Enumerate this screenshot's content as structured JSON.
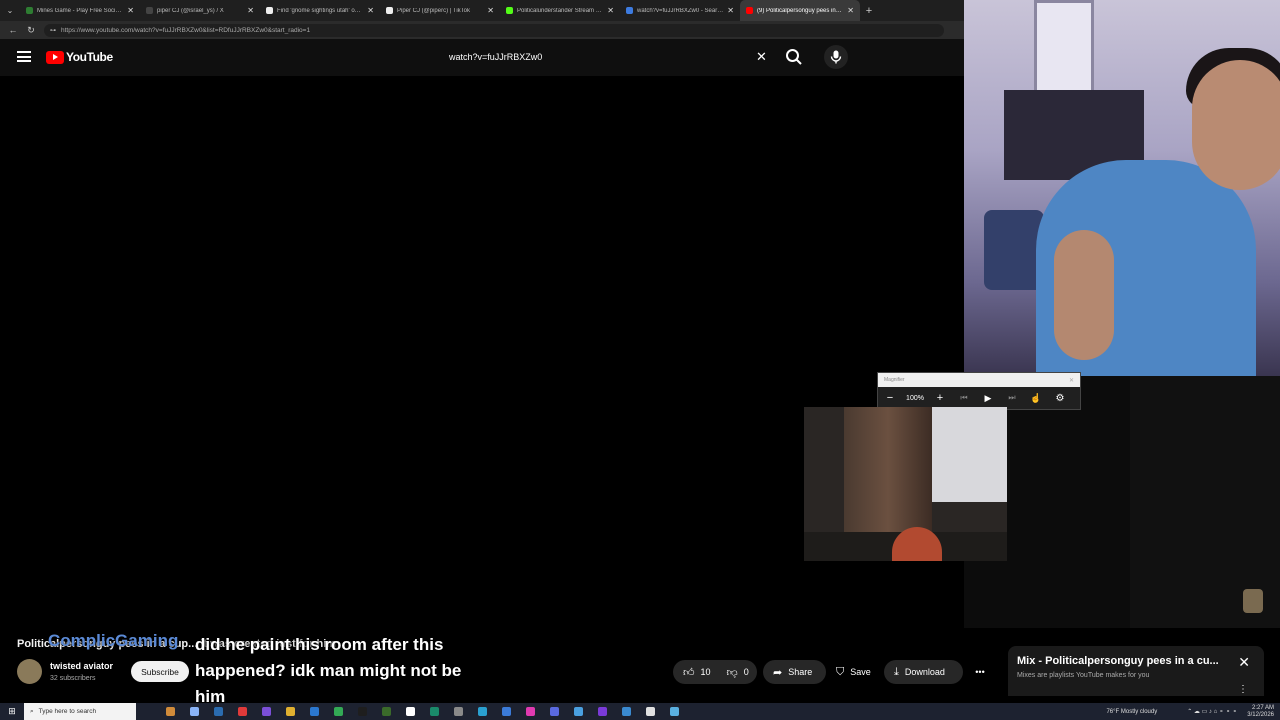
{
  "browser": {
    "tabs": [
      {
        "label": "Mines Game - Play Free Social Ca",
        "color": "#2e7d32",
        "active": false
      },
      {
        "label": "piper CJ (@israel_ys) / X",
        "color": "#222222",
        "active": false
      },
      {
        "label": "Find 'gnome sightings utah' on Ti",
        "color": "#111111",
        "active": false
      },
      {
        "label": "Piper CJ (@piperc) | TikTok",
        "color": "#111111",
        "active": false
      },
      {
        "label": "Politicalunderstander Stream - Wi",
        "color": "#53fc18",
        "active": false
      },
      {
        "label": "watch?v=fuJJrRBXZw0 - Search",
        "color": "#3d7be0",
        "active": false
      },
      {
        "label": "(9) Politicalpersonguy pees in a cu",
        "color": "#ff0000",
        "active": true
      }
    ],
    "url": "https://www.youtube.com/watch?v=fuJJrRBXZw0&list=RDfuJJrRBXZw0&start_radio=1"
  },
  "youtube": {
    "logo_text": "YouTube",
    "search_value": "watch?v=fuJJrRBXZw0"
  },
  "magnifier": {
    "title": "Magnifier",
    "zoom": "100%"
  },
  "video": {
    "title_underlay": "Politicalpersonguy pees in a cup... it was created just for him",
    "channel_name": "twisted aviator",
    "subscribers": "32 subscribers",
    "subscribe_label": "Subscribe",
    "likes": "10",
    "dislikes": "0",
    "share_label": "Share",
    "save_label": "Save",
    "download_label": "Download"
  },
  "chat_overlay": {
    "username": "ComplicGaming",
    "message": "did he paint his room after this happened? idk man might not be him"
  },
  "mix": {
    "title": "Mix - Politicalpersonguy pees in a cu...",
    "subtitle": "Mixes are playlists YouTube makes for you"
  },
  "taskbar": {
    "search_placeholder": "Type here to search",
    "weather": "76°F  Mostly cloudy",
    "time": "2:27 AM",
    "date": "3/12/2026",
    "icon_colors": [
      "#d08b3a",
      "#8ab4f8",
      "#2b6cb0",
      "#e03a3a",
      "#7b4fd8",
      "#e0b030",
      "#2b78d0",
      "#33aa55",
      "#1e1e1e",
      "#3a6a2a",
      "#ffffff",
      "#1a8a6a",
      "#8a8a8a",
      "#2aa0d0",
      "#3b7bd8",
      "#e03ab0",
      "#5a6ae0",
      "#4aa0e0",
      "#7a3ad8",
      "#3a8ad0",
      "#e0e0e0",
      "#5ab0e0"
    ]
  }
}
